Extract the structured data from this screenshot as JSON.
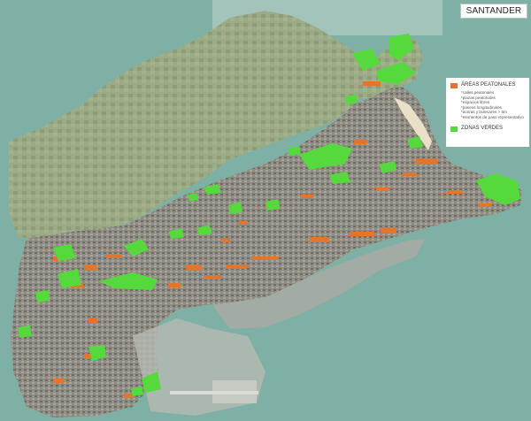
{
  "map": {
    "title": "SANTANDER",
    "legend": {
      "pedestrian": {
        "label": "ÁREAS PEATONALES",
        "color": "#e2762e",
        "items": [
          "*calles peatonales",
          "*plazas peatonales",
          "*espacios libres",
          "*paseos longitudinales",
          "*aceras y bulevares > 6m",
          "*elementos de paso representativo"
        ]
      },
      "green": {
        "label": "ZONAS VERDES",
        "color": "#55d93c"
      }
    },
    "colors": {
      "sea": "#7fb2a6",
      "land": "#9aab86",
      "urban": "#8f8d82",
      "pedestrian": "#e2762e",
      "green": "#55d93c"
    }
  }
}
